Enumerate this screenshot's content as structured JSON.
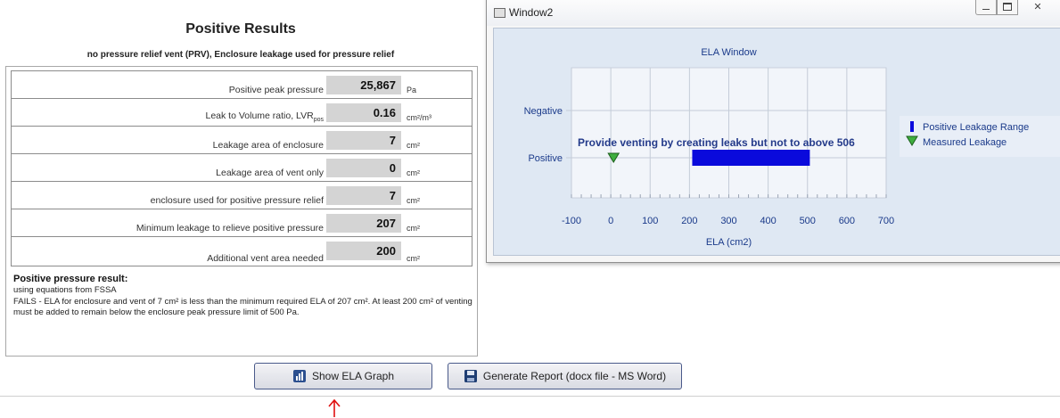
{
  "results": {
    "title": "Positive Results",
    "subtitle": "no pressure relief vent (PRV), Enclosure leakage used for pressure relief",
    "rows": [
      {
        "label": "Positive peak pressure",
        "value": "25,867",
        "unit": "Pa"
      },
      {
        "label_main": "Leak to Volume ratio, LVR",
        "label_sub": "pos",
        "value": "0.16",
        "unit": "cm²/m³"
      },
      {
        "label": "Leakage area of enclosure",
        "value": "7",
        "unit": "cm²"
      },
      {
        "label": "Leakage area of vent only",
        "value": "0",
        "unit": "cm²"
      },
      {
        "label": "enclosure  used for positive pressure relief",
        "value": "7",
        "unit": "cm²"
      },
      {
        "label": "Minimum leakage to relieve positive pressure",
        "value": "207",
        "unit": "cm²"
      },
      {
        "label": "Additional vent area needed",
        "value": "200",
        "unit": "cm²"
      }
    ],
    "result_heading": "Positive pressure result:",
    "result_body": "using equations from FSSA\nFAILS - ELA for enclosure and vent  of 7 cm² is less than the minimum required ELA of 207 cm².  At least 200 cm² of venting must be added to remain below the enclosure peak pressure limit of 500 Pa."
  },
  "buttons": {
    "show_graph": "Show ELA Graph",
    "generate_report": "Generate Report (docx file - MS Word)"
  },
  "window2": {
    "title": "Window2",
    "close_glyph": "✕"
  },
  "chart_data": {
    "type": "scatter",
    "title": "ELA Window",
    "xlabel": "ELA (cm2)",
    "ylabel": "",
    "xlim": [
      -100,
      700
    ],
    "x_ticks": [
      "-100",
      "0",
      "100",
      "200",
      "300",
      "400",
      "500",
      "600",
      "700"
    ],
    "y_categories": [
      "Negative",
      "Positive"
    ],
    "grid": true,
    "legend_position": "right",
    "annotation": "Provide venting by creating leaks but not to above 506",
    "series": [
      {
        "name": "Positive Leakage Range",
        "kind": "range-bar",
        "category": "Positive",
        "x_start": 207,
        "x_end": 506,
        "color": "#0a0adc"
      },
      {
        "name": "Measured Leakage",
        "kind": "marker",
        "category": "Positive",
        "x": 7,
        "color": "#3fae3f"
      }
    ]
  },
  "colors": {
    "range_bar": "#0a0adc",
    "marker_fill": "#3fae3f",
    "chart_text": "#1a3a8a",
    "red_arrow": "#e01010"
  },
  "icons": {
    "show_graph_icon": "bar-chart-icon",
    "generate_report_icon": "floppy-disk-icon"
  }
}
